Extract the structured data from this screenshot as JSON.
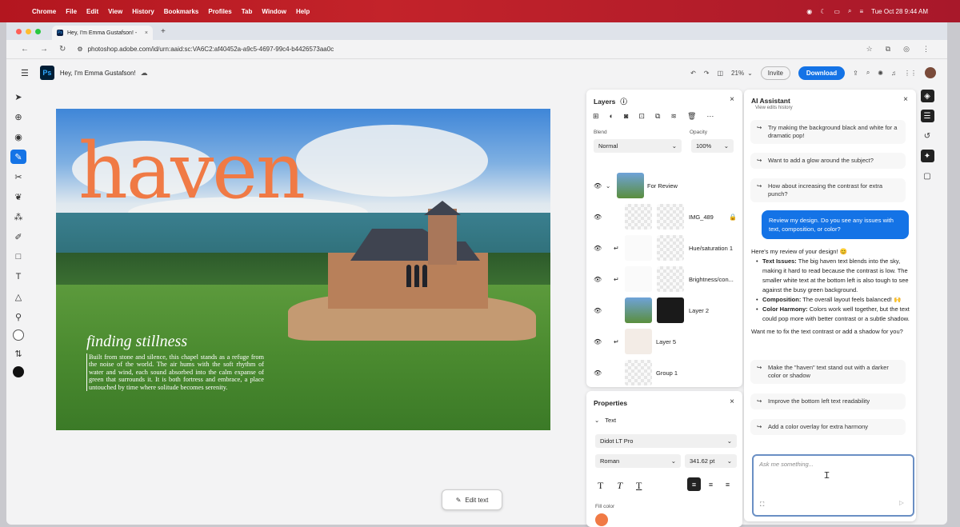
{
  "menubar": {
    "apple": "",
    "items": [
      "Chrome",
      "File",
      "Edit",
      "View",
      "History",
      "Bookmarks",
      "Profiles",
      "Tab",
      "Window",
      "Help"
    ],
    "clock": "Tue Oct 28  9:44 AM"
  },
  "browser": {
    "tab_title": "Hey, I'm Emma Gustafson! -",
    "tab_favicon": "Ps",
    "url": "photoshop.adobe.com/id/urn:aaid:sc:VA6C2:af40452a-a9c5-4697-99c4-b4426573aa0c"
  },
  "ps_header": {
    "logo": "Ps",
    "doc_name": "Hey, I'm Emma Gustafson!",
    "zoom": "21%",
    "invite": "Invite",
    "download": "Download"
  },
  "canvas": {
    "headline": "haven",
    "subhead": "finding stillness",
    "body": "Built from stone and silence, this chapel stands as a refuge from the noise of the world. The air hums with the soft rhythm of water and wind, each sound absorbed into the calm expanse of green that surrounds it. It is both fortress and embrace, a place untouched by time where solitude becomes serenity.",
    "edit_text": "Edit text"
  },
  "layers": {
    "title": "Layers",
    "blend_label": "Blend",
    "blend_value": "Normal",
    "opacity_label": "Opacity",
    "opacity_value": "100%",
    "rows": [
      {
        "name": "For Review"
      },
      {
        "name": "IMG_489"
      },
      {
        "name": "Hue/saturation 1"
      },
      {
        "name": "Brightness/con..."
      },
      {
        "name": "Layer 2"
      },
      {
        "name": "Layer 5"
      },
      {
        "name": "Group 1"
      }
    ]
  },
  "properties": {
    "title": "Properties",
    "section": "Text",
    "font": "Didot LT Pro",
    "style": "Roman",
    "size": "341.62 pt",
    "fill_label": "Fill color",
    "fill_color": "#f07a45"
  },
  "ai": {
    "title": "AI Assistant",
    "view_history": "View edits history",
    "suggestions_top": [
      "Try making the background black and white for a dramatic pop!",
      "Want to add a glow around the subject?",
      "How about increasing the contrast for extra punch?"
    ],
    "user_message": "Review my design. Do you see any issues with text, composition, or color?",
    "review_intro": "Here's my review of your design! 😊",
    "review_points": [
      {
        "label": "Text Issues:",
        "text": "The big haven text blends into the sky, making it hard to read because the contrast is low. The smaller white text at the bottom left is also tough to see against the busy green background."
      },
      {
        "label": "Composition:",
        "text": "The overall layout feels balanced! 🙌"
      },
      {
        "label": "Color Harmony:",
        "text": "Colors work well together, but the text could pop more with better contrast or a subtle shadow."
      }
    ],
    "question": "Want me to fix the text contrast or add a shadow for you?",
    "suggestions_bottom": [
      "Make the \"haven\" text stand out with a darker color or shadow",
      "Improve the bottom left text readability",
      "Add a color overlay for extra harmony"
    ],
    "ask_placeholder": "Ask me something..."
  }
}
